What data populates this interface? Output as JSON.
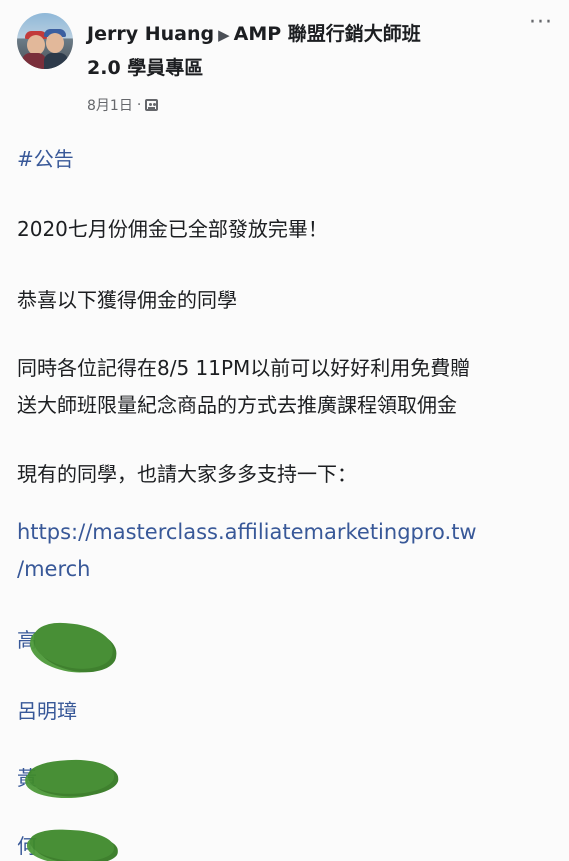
{
  "post": {
    "author": "Jerry Huang",
    "group_line1": "AMP 聯盟行銷大師班",
    "group_line2": "2.0 學員專區",
    "date": "8月1日",
    "more_label": "···",
    "body": {
      "hashtag": "#公告",
      "line1": "2020七月份佣金已全部發放完畢！",
      "line2": "恭喜以下獲得佣金的同學",
      "line3a": "同時各位記得在8/5 11PM以前可以好好利用免費贈",
      "line3b": "送大師班限量紀念商品的方式去推廣課程領取佣金",
      "line4": "現有的同學，也請大家多多支持一下：",
      "link_a": "https://masterclass.affiliatemarketingpro.tw",
      "link_b": "/merch",
      "names": [
        "高",
        "呂明璋",
        "黃",
        "何"
      ]
    }
  },
  "colors": {
    "link": "#385898",
    "redaction": "#3f8a2c",
    "meta_text": "#65676b"
  },
  "icons": {
    "arrow": "right-triangle",
    "privacy": "group-icon",
    "menu": "more-dots-icon"
  }
}
